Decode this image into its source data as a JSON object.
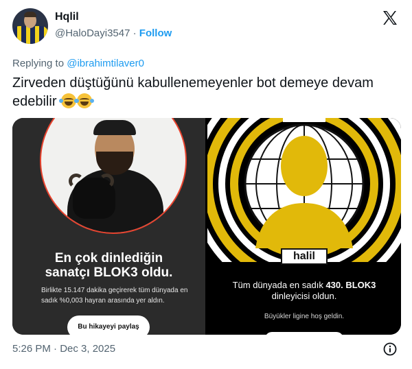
{
  "author": {
    "display_name": "Hqlil",
    "handle": "@HaloDayi3547",
    "separator": "·",
    "follow_label": "Follow"
  },
  "reply": {
    "prefix": "Replying to",
    "to_handle": "@ibrahimtilaver0"
  },
  "tweet": {
    "text": "Zirveden düştüğünü kabullenemeyenler bot demeye devam edebilir",
    "emoji": [
      "face-with-tears-of-joy",
      "face-with-tears-of-joy"
    ]
  },
  "media": {
    "left_card": {
      "title_line1": "En çok dinlediğin",
      "title_line2": "sanatçı BLOK3 oldu.",
      "body": "Birlikte 15.147 dakika geçirerek tüm dünyada en sadık %0,003 hayran arasında yer aldın.",
      "share_button": "Bu hikayeyi paylaş",
      "accent_color": "#e8432e"
    },
    "right_card": {
      "name_badge": "halil",
      "text_line1_prefix": "Tüm dünyada en sadık ",
      "text_line1_bold": "430. BLOK3",
      "text_line2": "dinleyicisi oldun.",
      "sub_text": "Büyükler ligine hoş geldin.",
      "accent_color": "#e1b90a"
    }
  },
  "footer": {
    "timestamp": "5:26 PM · Dec 3, 2025"
  },
  "icons": {
    "platform_logo": "x-logo-icon",
    "info": "info-icon"
  },
  "colors": {
    "link": "#1d9bf0",
    "secondary_text": "#536471"
  }
}
